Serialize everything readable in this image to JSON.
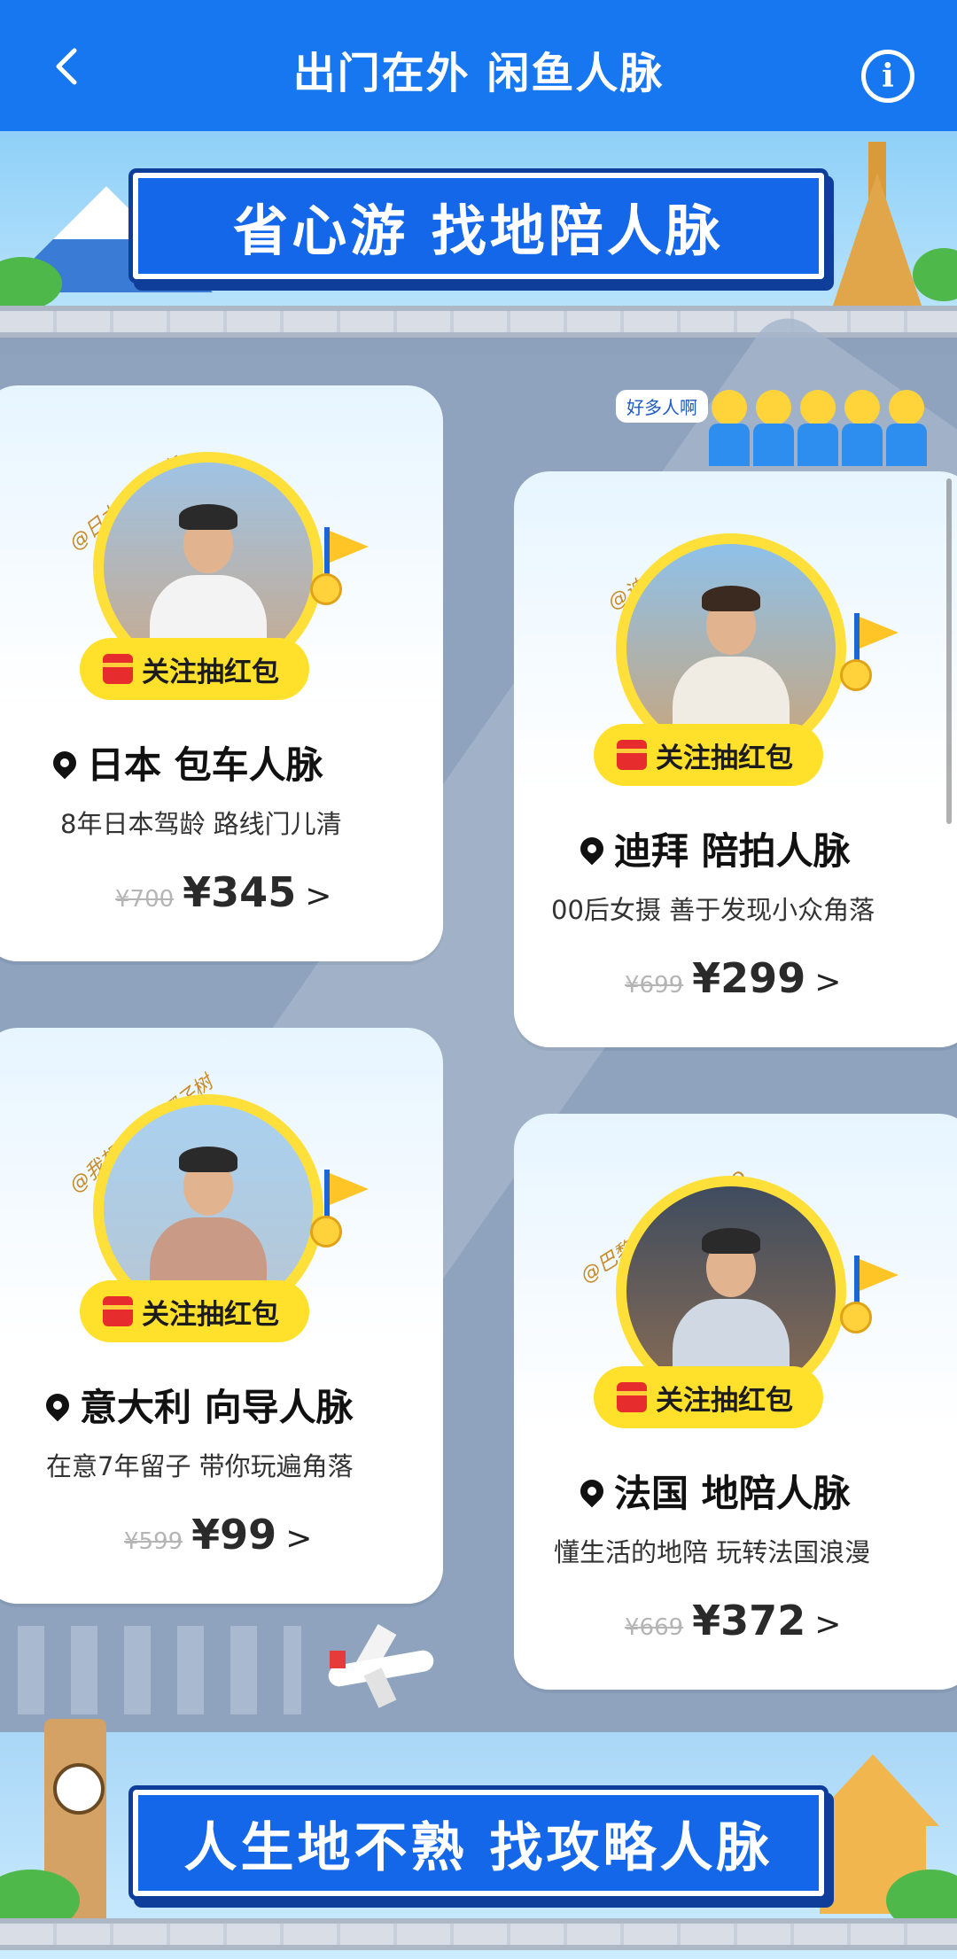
{
  "header": {
    "title": "出门在外 闲鱼人脉",
    "back_icon": "chevron-left-icon",
    "info_icon": "info-icon",
    "info_glyph": "i"
  },
  "banner_top": {
    "text": "省心游 找地陪人脉"
  },
  "banner_bottom": {
    "text": "人生地不熟 找攻略人脉"
  },
  "crowd_bubble": "好多人啊",
  "cards": [
    {
      "handle": "@日本全境包车",
      "follow_label": "关注抽红包",
      "title": "日本 包车人脉",
      "desc": "8年日本驾龄 路线门儿清",
      "old_price": "¥700",
      "price": "¥345",
      "chevron": ">"
    },
    {
      "handle": "@迪拜摄影",
      "follow_label": "关注抽红包",
      "title": "迪拜 陪拍人脉",
      "desc": "00后女摄 善于发现小众角落",
      "old_price": "¥699",
      "price": "¥299",
      "chevron": ">"
    },
    {
      "handle": "@我想要一棵椰子树",
      "follow_label": "关注抽红包",
      "title": "意大利 向导人脉",
      "desc": "在意7年留子 带你玩遍角落",
      "old_price": "¥599",
      "price": "¥99",
      "chevron": ">"
    },
    {
      "handle": "@巴黎半日绘STUDIO",
      "follow_label": "关注抽红包",
      "title": "法国 地陪人脉",
      "desc": "懂生活的地陪 玩转法国浪漫",
      "old_price": "¥669",
      "price": "¥372",
      "chevron": ">"
    }
  ],
  "colors": {
    "header_bg": "#1677f0",
    "banner_bg": "#1467e8",
    "pill_yellow": "#ffe12c",
    "page_bg": "#8da1bd"
  }
}
